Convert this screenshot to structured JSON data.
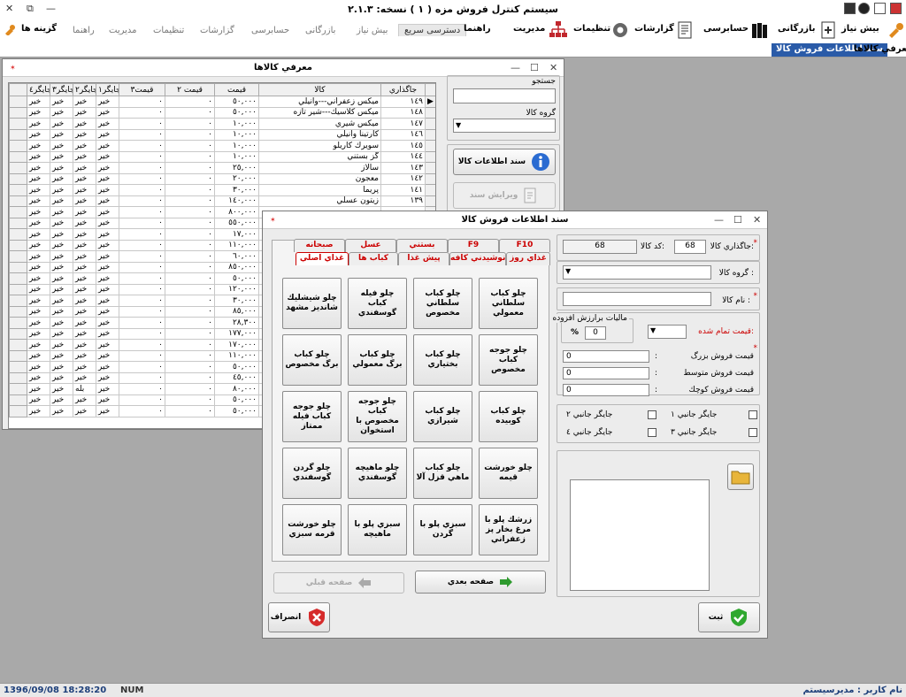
{
  "app": {
    "title": "سيستم كنترل فروش مزه ( ١ )   نسخه: ٢.١.٣"
  },
  "ribbon": {
    "menus": [
      "گزینه ها",
      "بیش نیاز",
      "بازرگانی",
      "حسابرسی",
      "گزارشات",
      "تنظیمات",
      "مدیریت",
      "راهنما"
    ],
    "tabs": [
      "دسترسی سریع",
      "بیش نیاز",
      "بازرگانی",
      "حسابرسی",
      "گزارشات",
      "تنظیمات",
      "مدیریت",
      "راهنما"
    ]
  },
  "doctabs": [
    "سند اطلاعات فروش كالا",
    "معرفي كالاها"
  ],
  "goods_window": {
    "title": "معرفي كالاها",
    "search_label": "جستجو",
    "group_label": "گروه كالا",
    "btn_info": "سند اطلاعات كالا",
    "btn_edit": "ويرايش سند",
    "columns": [
      "جاگذاري",
      "كالا",
      "قيمت",
      "قيمت ٢",
      "قيمت٣",
      "جايگر١",
      "جايگر٢",
      "جايگر٣",
      "جايگر٤"
    ],
    "rows": [
      [
        "١٤٩",
        "ميكس زعفراني---وانيلي",
        "٥٠,٠٠٠",
        "٠",
        "٠",
        "خير",
        "خير",
        "خير",
        "خير"
      ],
      [
        "١٤٨",
        "ميكس كلاسيك---شير تازه",
        "٥٠,٠٠٠",
        "٠",
        "٠",
        "خير",
        "خير",
        "خير",
        "خير"
      ],
      [
        "١٤٧",
        "ميكس شيري",
        "١٠,٠٠٠",
        "٠",
        "٠",
        "خير",
        "خير",
        "خير",
        "خير"
      ],
      [
        "١٤٦",
        "كارتينا وانيلي",
        "١٠,٠٠٠",
        "٠",
        "٠",
        "خير",
        "خير",
        "خير",
        "خير"
      ],
      [
        "١٤٥",
        "سويرك كاريلو",
        "١٠,٠٠٠",
        "٠",
        "٠",
        "خير",
        "خير",
        "خير",
        "خير"
      ],
      [
        "١٤٤",
        "گز بستني",
        "١٠,٠٠٠",
        "٠",
        "٠",
        "خير",
        "خير",
        "خير",
        "خير"
      ],
      [
        "١٤٣",
        "سالاز",
        "٢٥,٠٠٠",
        "٠",
        "٠",
        "خير",
        "خير",
        "خير",
        "خير"
      ],
      [
        "١٤٢",
        "معجون",
        "٢٠,٠٠٠",
        "٠",
        "٠",
        "خير",
        "خير",
        "خير",
        "خير"
      ],
      [
        "١٤١",
        "پريما",
        "٣٠,٠٠٠",
        "٠",
        "٠",
        "خير",
        "خير",
        "خير",
        "خير"
      ],
      [
        "١٣٩",
        "زيتون عسلي",
        "١٤٠,٠٠٠",
        "٠",
        "٠",
        "خير",
        "خير",
        "خير",
        "خير"
      ],
      [
        "",
        "",
        "٨٠٠,٠٠٠",
        "٠",
        "٠",
        "خير",
        "خير",
        "خير",
        "خير"
      ],
      [
        "",
        "",
        "٥٥٠,٠٠٠",
        "٠",
        "٠",
        "خير",
        "خير",
        "خير",
        "خير"
      ],
      [
        "",
        "",
        "١٧,٠٠٠",
        "٠",
        "٠",
        "خير",
        "خير",
        "خير",
        "خير"
      ],
      [
        "",
        "",
        "١١٠,٠٠٠",
        "٠",
        "٠",
        "خير",
        "خير",
        "خير",
        "خير"
      ],
      [
        "",
        "",
        "٦٠,٠٠٠",
        "٠",
        "٠",
        "خير",
        "خير",
        "خير",
        "خير"
      ],
      [
        "",
        "",
        "٨٥٠,٠٠٠",
        "٠",
        "٠",
        "خير",
        "خير",
        "خير",
        "خير"
      ],
      [
        "",
        "",
        "٥٠,٠٠٠",
        "٠",
        "٠",
        "خير",
        "خير",
        "خير",
        "خير"
      ],
      [
        "",
        "",
        "١٢٠,٠٠٠",
        "٠",
        "٠",
        "خير",
        "خير",
        "خير",
        "خير"
      ],
      [
        "",
        "",
        "٣٠,٠٠٠",
        "٠",
        "٠",
        "خير",
        "خير",
        "خير",
        "خير"
      ],
      [
        "",
        "",
        "٨٥,٠٠٠",
        "٠",
        "٠",
        "خير",
        "خير",
        "خير",
        "خير"
      ],
      [
        "",
        "",
        "٢٨,٣٠٠",
        "٠",
        "٠",
        "خير",
        "خير",
        "خير",
        "خير"
      ],
      [
        "",
        "",
        "١٧٧,٠٠٠",
        "٠",
        "٠",
        "خير",
        "خير",
        "خير",
        "خير"
      ],
      [
        "",
        "",
        "١٧٠,٠٠٠",
        "٠",
        "٠",
        "خير",
        "خير",
        "خير",
        "خير"
      ],
      [
        "",
        "",
        "١١٠,٠٠٠",
        "٠",
        "٠",
        "خير",
        "خير",
        "خير",
        "خير"
      ],
      [
        "",
        "",
        "٥٠,٠٠٠",
        "٠",
        "٠",
        "خير",
        "خير",
        "خير",
        "خير"
      ],
      [
        "",
        "",
        "٤٥,٠٠٠",
        "٠",
        "٠",
        "خير",
        "خير",
        "خير",
        "خير"
      ],
      [
        "",
        "",
        "٨٠,٠٠٠",
        "٠",
        "٠",
        "خير",
        "بله",
        "خير",
        "خير"
      ],
      [
        "",
        "",
        "٥٠,٠٠٠",
        "٠",
        "٠",
        "خير",
        "خير",
        "خير",
        "خير"
      ],
      [
        "",
        "",
        "٥٠,٠٠٠",
        "٠",
        "٠",
        "خير",
        "خير",
        "خير",
        "خير"
      ]
    ]
  },
  "dialog": {
    "title": "سند اطلاعات فروش كالا",
    "tabs_row1": [
      "F10",
      "F9",
      "بستني",
      "عسل",
      "صبحانه"
    ],
    "tabs_row2": [
      "غذاي روز",
      "نوشيدني كافه",
      "پيش غذا",
      "كباب ها",
      "غذاي اصلي"
    ],
    "foods": [
      "چلو كباب سلطاني معمولي",
      "چلو كباب سلطاني مخصوص",
      "چلو فيله كباب گوسفندي",
      "چلو شيشليك شانديز مشهد",
      "چلو جوجه كباب مخصوص",
      "چلو كباب بختياري",
      "چلو كباب برگ معمولي",
      "چلو كباب برگ مخصوص",
      "چلو كباب كوبيده",
      "چلو كباب شيرازي",
      "چلو جوجه كباب مخصوص با استخوان",
      "چلو جوجه كباب فيله ممتاز",
      "چلو خورشت قيمه",
      "چلو كباب ماهي قزل آلا",
      "چلو ماهيچه گوسفندي",
      "چلو گردن گوسفندي",
      "زرشك پلو با مرغ بخار پز زعفراني",
      "سبزي پلو با گردن",
      "سبزي پلو با ماهيچه",
      "چلو خورشت قرمه سبزي"
    ],
    "btn_next": "صفحه بعدي",
    "btn_prev": "صفحه قبلي",
    "btn_cancel": "انصراف",
    "btn_save": "ثبت",
    "placement_label": "جاگذاري كالا:",
    "placement_value": "68",
    "code_label": "كد كالا:",
    "code_value": "68",
    "group_label": "گروه كالا :",
    "name_label": "نام كالا :",
    "vat_label": "ماليات برارزش افزوده",
    "vat_value": "0",
    "vat_unit": "%",
    "final_price_label": "قيمت تمام شده:",
    "price_large_label": "قيمت فروش بزرگ",
    "price_large_value": "0",
    "price_medium_label": "قيمت فروش متوسط",
    "price_medium_value": "0",
    "price_small_label": "قيمت فروش كوچك",
    "price_small_value": "0",
    "colon": ":",
    "side1": "جايگر جانبي ١",
    "side2": "جايگر جانبي ٢",
    "side3": "جايگر جانبي ٣",
    "side4": "جايگر جانبي ٤"
  },
  "status": {
    "user": "نام كاربر : مديرسيستم",
    "datetime": "1396/09/08 18:28:20",
    "num": "NUM"
  }
}
